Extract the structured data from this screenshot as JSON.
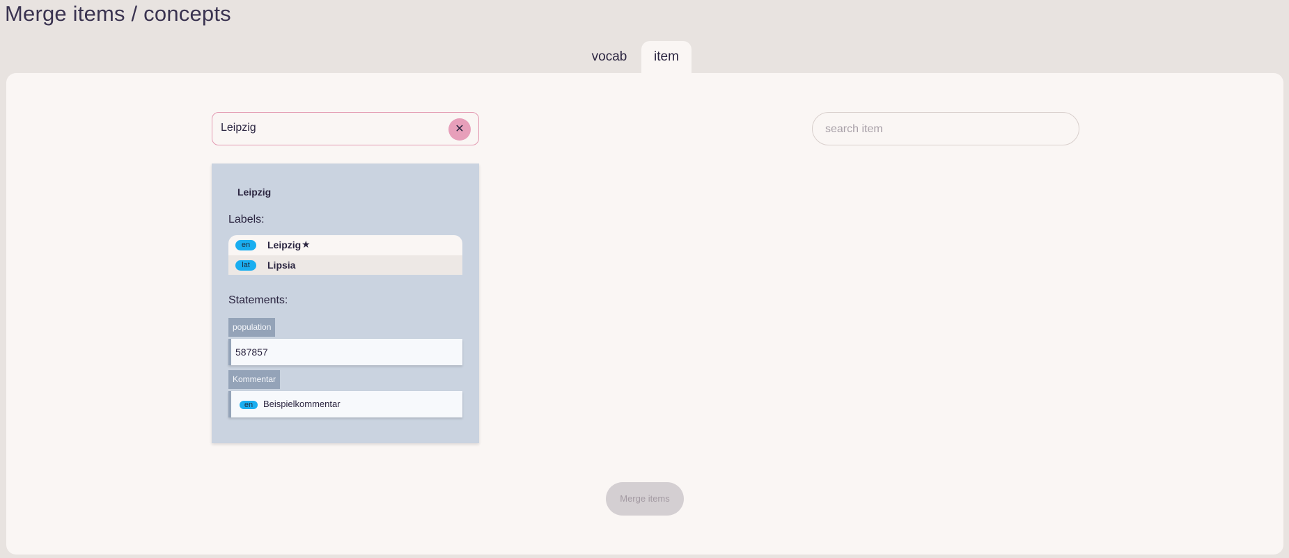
{
  "page": {
    "title": "Merge items / concepts"
  },
  "tabs": [
    {
      "label": "vocab",
      "active": false
    },
    {
      "label": "item",
      "active": true
    }
  ],
  "left_search": {
    "value": "Leipzig",
    "clear_icon": "close-icon"
  },
  "right_search": {
    "value": "",
    "placeholder": "search item"
  },
  "item_card": {
    "title": "Leipzig",
    "labels_heading": "Labels:",
    "labels": [
      {
        "lang": "en",
        "text": "Leipzig",
        "preferred": true,
        "icon": "star-icon"
      },
      {
        "lang": "lat",
        "text": "Lipsia",
        "preferred": false
      }
    ],
    "statements_heading": "Statements:",
    "statements": [
      {
        "property": "population",
        "value": "587857"
      },
      {
        "property": "Kommentar",
        "lang": "en",
        "value": "Beispielkommentar"
      }
    ]
  },
  "actions": {
    "merge_label": "Merge items",
    "merge_enabled": false
  },
  "colors": {
    "background": "#e8e3e0",
    "panel": "#faf6f4",
    "card": "#cad3e0",
    "lang_badge": "#1aaef0",
    "clear_button": "#e79fba",
    "property_badge": "#94a3b8"
  }
}
